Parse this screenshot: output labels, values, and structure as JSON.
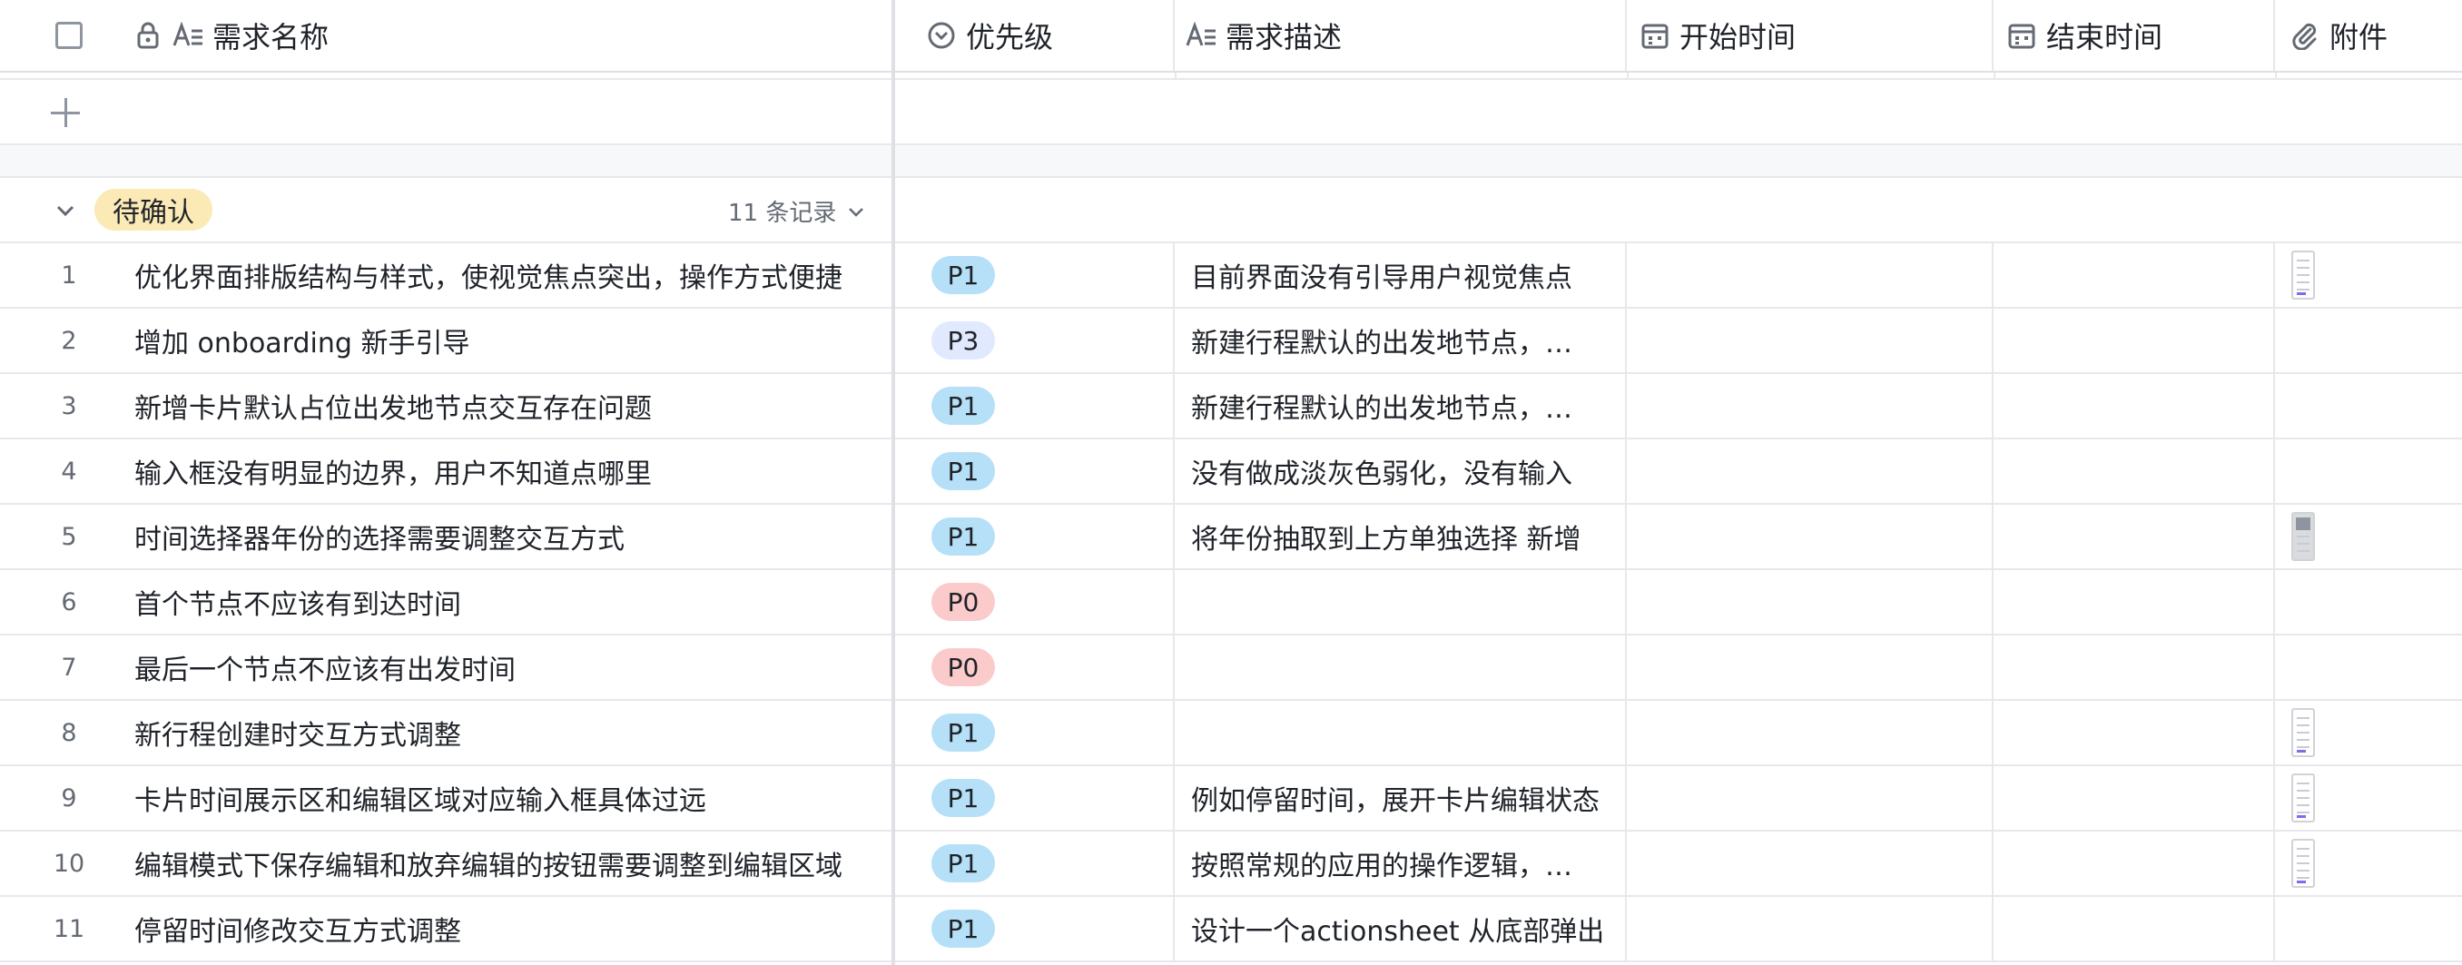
{
  "columns": {
    "name": "需求名称",
    "priority": "优先级",
    "description": "需求描述",
    "start_time": "开始时间",
    "end_time": "结束时间",
    "attachment": "附件"
  },
  "group": {
    "label": "待确认",
    "count": "11 条记录"
  },
  "priority_colors": {
    "P0": "#fbcbcb",
    "P1": "#b6e0f7",
    "P3": "#e0e9fd"
  },
  "group_color": "#fbe9b6",
  "rows": [
    {
      "num": "1",
      "name": "优化界面排版结构与样式，使视觉焦点突出，操作方式便捷",
      "priority": "P1",
      "description": "目前界面没有引导用户视觉焦点",
      "start": "",
      "end": "",
      "attachment": "light"
    },
    {
      "num": "2",
      "name": "增加 onboarding 新手引导",
      "priority": "P3",
      "description": "新建行程默认的出发地节点，…",
      "start": "",
      "end": "",
      "attachment": ""
    },
    {
      "num": "3",
      "name": "新增卡片默认占位出发地节点交互存在问题",
      "priority": "P1",
      "description": "新建行程默认的出发地节点，…",
      "start": "",
      "end": "",
      "attachment": ""
    },
    {
      "num": "4",
      "name": "输入框没有明显的边界，用户不知道点哪里",
      "priority": "P1",
      "description": "没有做成淡灰色弱化，没有输入",
      "start": "",
      "end": "",
      "attachment": ""
    },
    {
      "num": "5",
      "name": "时间选择器年份的选择需要调整交互方式",
      "priority": "P1",
      "description": "将年份抽取到上方单独选择 新增",
      "start": "",
      "end": "",
      "attachment": "dark"
    },
    {
      "num": "6",
      "name": "首个节点不应该有到达时间",
      "priority": "P0",
      "description": "",
      "start": "",
      "end": "",
      "attachment": ""
    },
    {
      "num": "7",
      "name": "最后一个节点不应该有出发时间",
      "priority": "P0",
      "description": "",
      "start": "",
      "end": "",
      "attachment": ""
    },
    {
      "num": "8",
      "name": "新行程创建时交互方式调整",
      "priority": "P1",
      "description": "",
      "start": "",
      "end": "",
      "attachment": "light"
    },
    {
      "num": "9",
      "name": "卡片时间展示区和编辑区域对应输入框具体过远",
      "priority": "P1",
      "description": "例如停留时间，展开卡片编辑状态",
      "start": "",
      "end": "",
      "attachment": "light"
    },
    {
      "num": "10",
      "name": "编辑模式下保存编辑和放弃编辑的按钮需要调整到编辑区域",
      "priority": "P1",
      "description": "按照常规的应用的操作逻辑，…",
      "start": "",
      "end": "",
      "attachment": "light"
    },
    {
      "num": "11",
      "name": "停留时间修改交互方式调整",
      "priority": "P1",
      "description": "设计一个actionsheet 从底部弹出",
      "start": "",
      "end": "",
      "attachment": ""
    }
  ]
}
